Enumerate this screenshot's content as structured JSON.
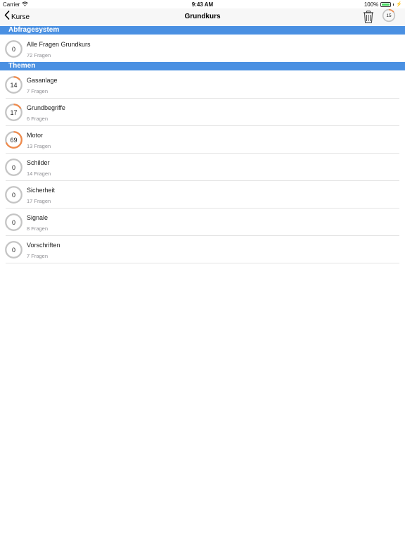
{
  "status_bar": {
    "carrier": "Carrier",
    "time": "9:43 AM",
    "battery": "100%",
    "battery_color": "#4cd964"
  },
  "nav": {
    "back_label": "Kurse",
    "back_icon": "chevron-left-icon",
    "title": "Grundkurs",
    "trash_icon": "trash-icon",
    "score": "15",
    "score_progress": 0.15
  },
  "colors": {
    "section_header": "#4a90e2",
    "progress": "#f08a4b",
    "ring_track": "#c4c4c4"
  },
  "sections": [
    {
      "header": "Abfragesystem",
      "rows": [
        {
          "value": "0",
          "progress": 0,
          "title": "Alle Fragen Grundkurs",
          "subtitle": "72 Fragen"
        }
      ]
    },
    {
      "header": "Themen",
      "rows": [
        {
          "value": "14",
          "progress": 0.14,
          "title": "Gasanlage",
          "subtitle": "7 Fragen"
        },
        {
          "value": "17",
          "progress": 0.17,
          "title": "Grundbegriffe",
          "subtitle": "6 Fragen"
        },
        {
          "value": "69",
          "progress": 0.69,
          "title": "Motor",
          "subtitle": "13 Fragen"
        },
        {
          "value": "0",
          "progress": 0,
          "title": "Schilder",
          "subtitle": "14 Fragen"
        },
        {
          "value": "0",
          "progress": 0,
          "title": "Sicherheit",
          "subtitle": "17 Fragen"
        },
        {
          "value": "0",
          "progress": 0,
          "title": "Signale",
          "subtitle": "8 Fragen"
        },
        {
          "value": "0",
          "progress": 0,
          "title": "Vorschriften",
          "subtitle": "7 Fragen"
        }
      ]
    }
  ]
}
